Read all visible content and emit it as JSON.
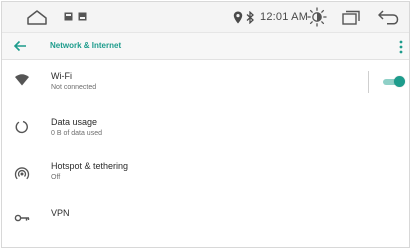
{
  "status_bar": {
    "time": "12:01 AM",
    "icons": [
      "home-icon",
      "notification-badge-icon",
      "notification-badge-icon",
      "location-icon",
      "bluetooth-icon",
      "brightness-icon",
      "recents-icon",
      "back-icon"
    ]
  },
  "app_bar": {
    "title": "Network & Internet",
    "back_icon": "arrow-left-icon",
    "menu_icon": "more-vert-icon",
    "accent": "#1d9c8c"
  },
  "settings": [
    {
      "icon": "wifi-icon",
      "title": "Wi-Fi",
      "subtitle": "Not connected",
      "toggle": true,
      "toggle_on": true
    },
    {
      "icon": "data-usage-icon",
      "title": "Data usage",
      "subtitle": "0 B of data used"
    },
    {
      "icon": "hotspot-icon",
      "title": "Hotspot & tethering",
      "subtitle": "Off"
    },
    {
      "icon": "vpn-key-icon",
      "title": "VPN",
      "subtitle": ""
    }
  ]
}
